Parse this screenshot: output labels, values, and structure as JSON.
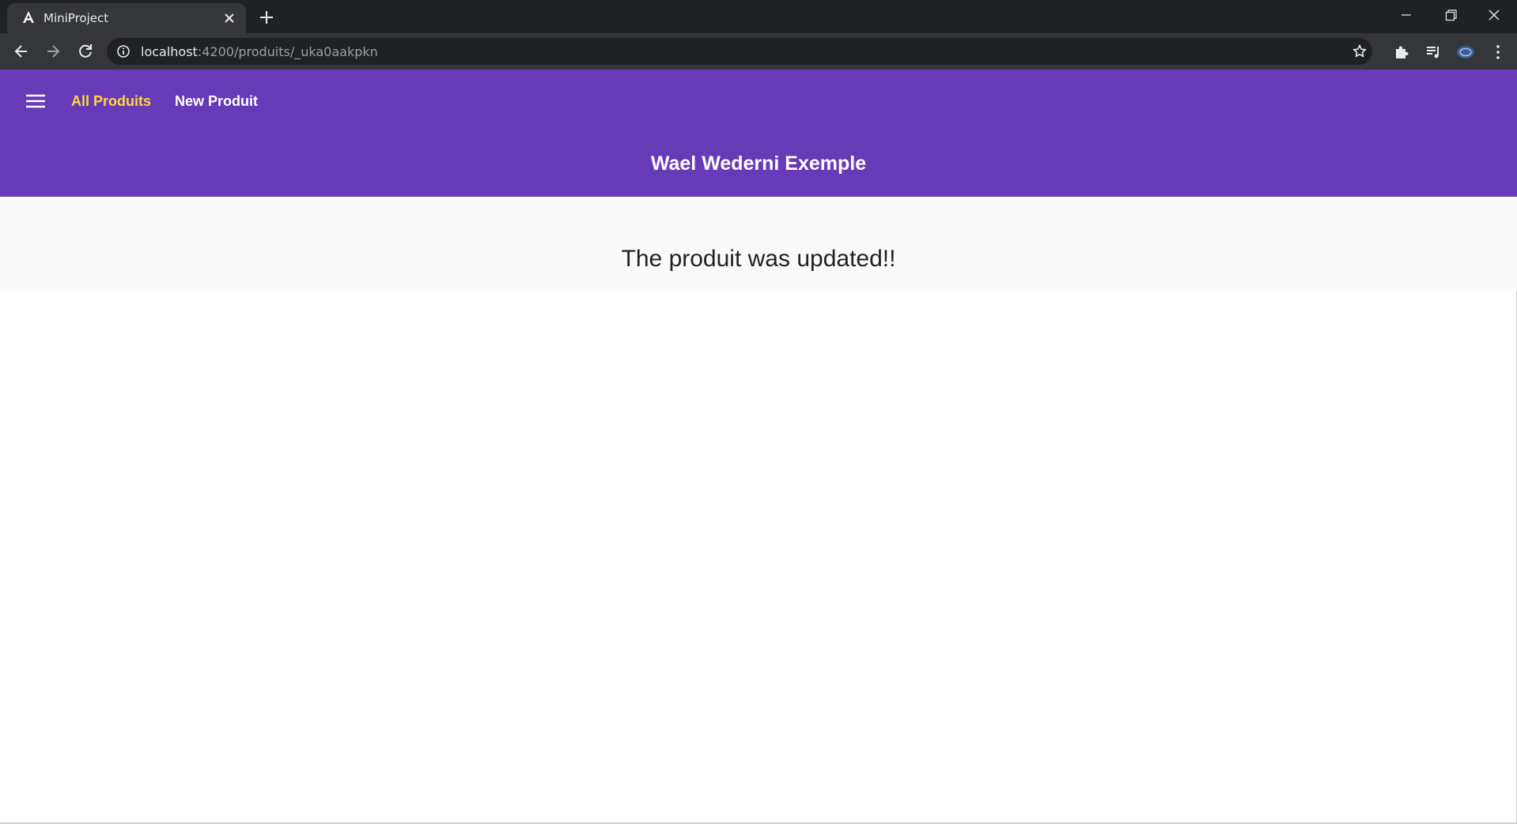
{
  "browser": {
    "tab": {
      "title": "MiniProject",
      "favicon": "angular-logo-icon"
    },
    "address": {
      "host": "localhost",
      "path": ":4200/produits/_uka0aakpkn"
    }
  },
  "app": {
    "nav": {
      "all_label": "All Produits",
      "new_label": "New Produit"
    },
    "title": "Wael Wederni Exemple",
    "message": "The produit was updated!!",
    "colors": {
      "header": "#673ab7",
      "active_link": "#ffd740"
    }
  }
}
